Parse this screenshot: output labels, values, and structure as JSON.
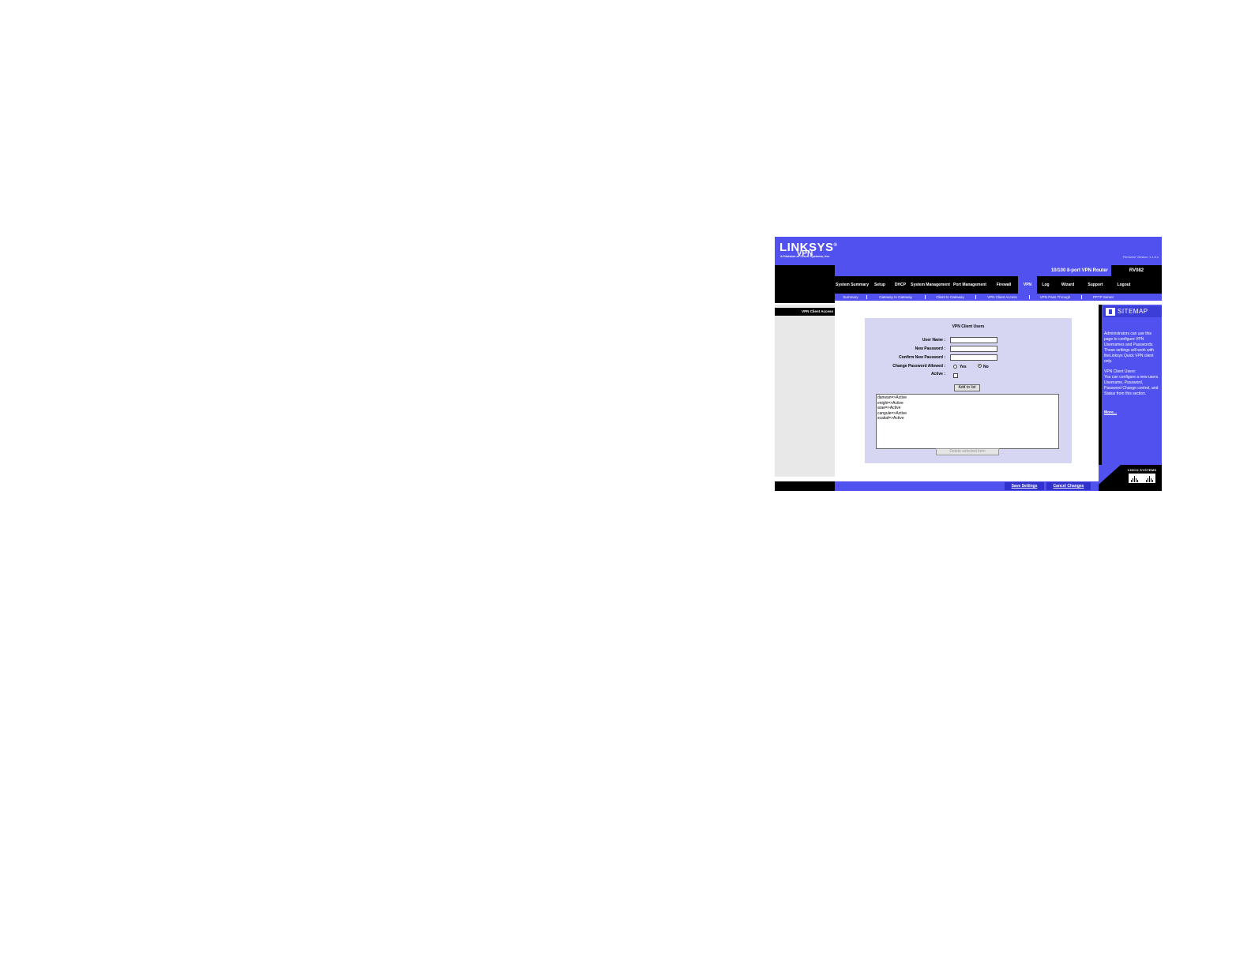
{
  "brand": {
    "logo": "LINKSYS",
    "tagline": "A Division of Cisco Systems, Inc.",
    "firmware": "Firmware Version: 1.1.0.x"
  },
  "header": {
    "page_title": "VPN",
    "product_name": "10/100 8-port VPN Router",
    "model": "RV082"
  },
  "tabs": [
    {
      "label": "System Summary"
    },
    {
      "label": "Setup"
    },
    {
      "label": "DHCP"
    },
    {
      "label": "System Management"
    },
    {
      "label": "Port Management"
    },
    {
      "label": "Firewall"
    },
    {
      "label": "VPN",
      "active": true
    },
    {
      "label": "Log"
    },
    {
      "label": "Wizard"
    },
    {
      "label": "Support"
    },
    {
      "label": "Logout"
    }
  ],
  "subtabs": [
    {
      "label": "Summary"
    },
    {
      "label": "Gateway to Gateway"
    },
    {
      "label": "Client to Gateway"
    },
    {
      "label": "VPN Client Access",
      "active": true
    },
    {
      "label": "VPN Pass Through"
    },
    {
      "label": "PPTP Server"
    }
  ],
  "sidebar": {
    "section_label": "VPN Client Access"
  },
  "form": {
    "title": "VPN Client Users",
    "user_name_label": "User Name :",
    "user_name_value": "",
    "new_password_label": "New Password :",
    "new_password_value": "",
    "confirm_password_label": "Confirm New Password :",
    "confirm_password_value": "",
    "change_password_label": "Change Password Allowed :",
    "change_password_options": [
      "Yes",
      "No"
    ],
    "change_password_selected": "No",
    "active_label": "Active :",
    "active_checked": false,
    "add_button": "Add to list",
    "users": [
      "danwan=>Active",
      "enighi=>Active",
      "arae=>Active",
      "cangule=>Active",
      "scakal=>Active"
    ],
    "delete_button": "Delete selected item"
  },
  "sitemap": {
    "title": "SITEMAP",
    "help_intro": "Administrators can use this page to configure VPN Usernames and Passwords. These settings will work with theLinksys Quick VPN client only.",
    "help_title": "VPN Client Users:",
    "help_body": "You can configure a new users Username, Password, Password Change control, and Status from this section.",
    "more": "More...",
    "cisco": "CISCO SYSTEMS"
  },
  "footer": {
    "save": "Save Settings",
    "cancel": "Cancel Changes"
  },
  "colors": {
    "brand_blue": "#5151ef",
    "panel_lavender": "#d6d6f2",
    "black": "#000000"
  }
}
